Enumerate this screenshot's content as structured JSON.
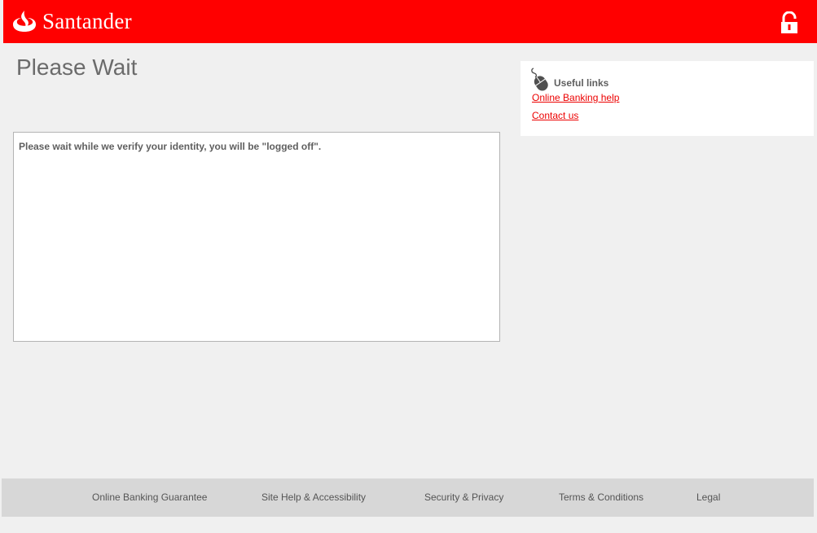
{
  "header": {
    "brand": "Santander",
    "logo_icon": "flame-icon",
    "lock_icon": "lock-icon",
    "brand_color": "#ff0000"
  },
  "page": {
    "title": "Please Wait"
  },
  "message": {
    "text": "Please wait while we verify your identity, you will be \"logged off\"."
  },
  "useful_links": {
    "icon": "mouse-icon",
    "title": "Useful links",
    "items": [
      {
        "label": "Online Banking help"
      },
      {
        "label": "Contact us"
      }
    ],
    "link_color": "#ec0000"
  },
  "footer": {
    "links": [
      {
        "label": "Online Banking Guarantee"
      },
      {
        "label": "Site Help & Accessibility"
      },
      {
        "label": "Security & Privacy"
      },
      {
        "label": "Terms & Conditions"
      },
      {
        "label": "Legal"
      }
    ]
  }
}
